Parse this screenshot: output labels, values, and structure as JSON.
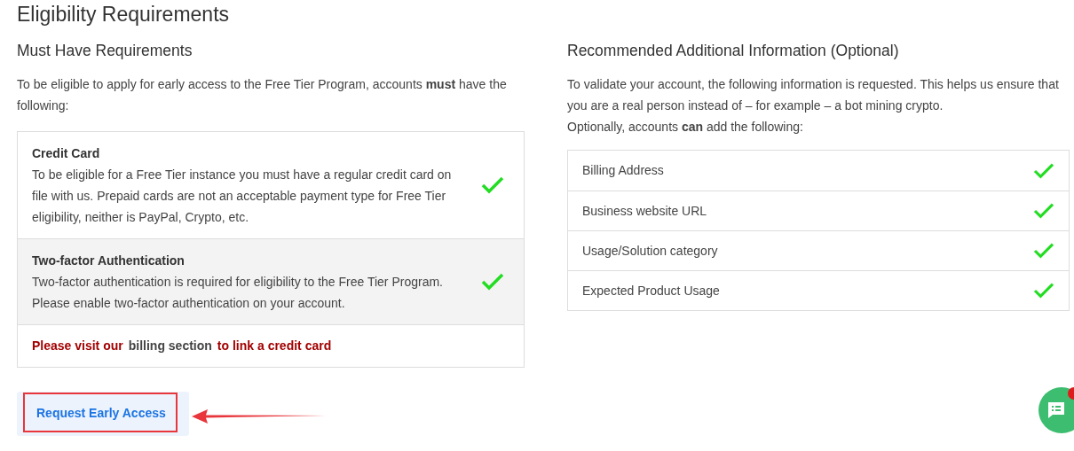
{
  "title": "Eligibility Requirements",
  "must_have": {
    "heading": "Must Have Requirements",
    "intro": "To be eligible to apply for early access to the Free Tier Program, accounts **must** have the following:",
    "items": [
      {
        "title": "Credit Card",
        "description": "To be eligible for a Free Tier instance you must have a regular credit card on file with us. Prepaid cards are not an acceptable payment type for Free Tier eligibility, neither is PayPal, Crypto, etc.",
        "checked": true,
        "highlighted": false
      },
      {
        "title": "Two-factor Authentication",
        "description": "Two-factor authentication is required for eligibility to the Free Tier Program. Please enable two-factor authentication on your account.",
        "checked": true,
        "highlighted": true
      }
    ],
    "notice": {
      "before": "Please visit our",
      "link": "billing section",
      "after": "to link a credit card"
    }
  },
  "recommended": {
    "heading": "Recommended Additional Information (Optional)",
    "intro": [
      "To validate your account, the following information is requested. This helps us ensure that you are a real person instead of – for example – a bot mining crypto.",
      "Optionally, accounts **can** add the following:"
    ],
    "items": [
      {
        "label": "Billing Address",
        "checked": true
      },
      {
        "label": "Business website URL",
        "checked": true
      },
      {
        "label": "Usage/Solution category",
        "checked": true
      },
      {
        "label": "Expected Product Usage",
        "checked": true
      }
    ]
  },
  "request_button": "Request Early Access",
  "chat": {
    "has_notification": true
  }
}
